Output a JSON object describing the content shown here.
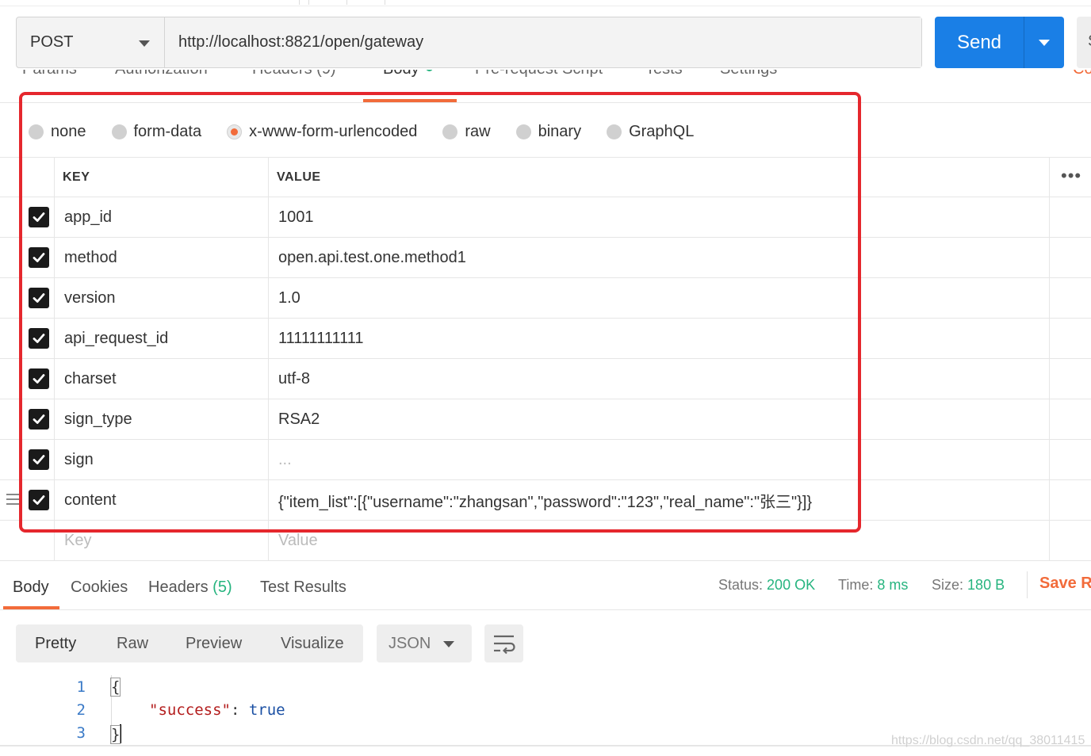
{
  "request": {
    "method": "POST",
    "url": "http://localhost:8821/open/gateway",
    "send_label": "Send",
    "save_stub": "S"
  },
  "request_tabs": {
    "params": "Params",
    "authorization": "Authorization",
    "headers": "Headers (9)",
    "body": "Body",
    "pre_request": "Pre-request Script",
    "tests": "Tests",
    "settings": "Settings",
    "cookies": "Co"
  },
  "body_types": {
    "none": "none",
    "form_data": "form-data",
    "urlencoded": "x-www-form-urlencoded",
    "raw": "raw",
    "binary": "binary",
    "graphql": "GraphQL",
    "selected": "x-www-form-urlencoded"
  },
  "table": {
    "key_header": "KEY",
    "value_header": "VALUE",
    "more": "•••",
    "rows": [
      {
        "key": "app_id",
        "value": "1001"
      },
      {
        "key": "method",
        "value": "open.api.test.one.method1"
      },
      {
        "key": "version",
        "value": "1.0"
      },
      {
        "key": "api_request_id",
        "value": "11111111111"
      },
      {
        "key": "charset",
        "value": "utf-8"
      },
      {
        "key": "sign_type",
        "value": "RSA2"
      },
      {
        "key": "sign",
        "value": "..."
      },
      {
        "key": "content",
        "value": "{\"item_list\":[{\"username\":\"zhangsan\",\"password\":\"123\",\"real_name\":\"张三\"}]}"
      }
    ],
    "key_placeholder": "Key",
    "value_placeholder": "Value"
  },
  "response_tabs": {
    "body": "Body",
    "cookies": "Cookies",
    "headers": "Headers",
    "headers_count": "(5)",
    "test_results": "Test Results"
  },
  "response_meta": {
    "status_label": "Status:",
    "status_value": "200 OK",
    "time_label": "Time:",
    "time_value": "8 ms",
    "size_label": "Size:",
    "size_value": "180 B",
    "save_response": "Save Re"
  },
  "view_modes": {
    "pretty": "Pretty",
    "raw": "Raw",
    "preview": "Preview",
    "visualize": "Visualize",
    "format": "JSON"
  },
  "code": {
    "lines": [
      "1",
      "2",
      "3"
    ],
    "open_brace": "{",
    "key": "\"success\"",
    "colon": ": ",
    "value": "true",
    "close_brace": "}"
  },
  "watermark": "https://blog.csdn.net/qq_38011415",
  "colors": {
    "accent": "#f26b3a",
    "send": "#1a7fe6",
    "success": "#26b47f",
    "highlight_box": "#e5272d"
  }
}
